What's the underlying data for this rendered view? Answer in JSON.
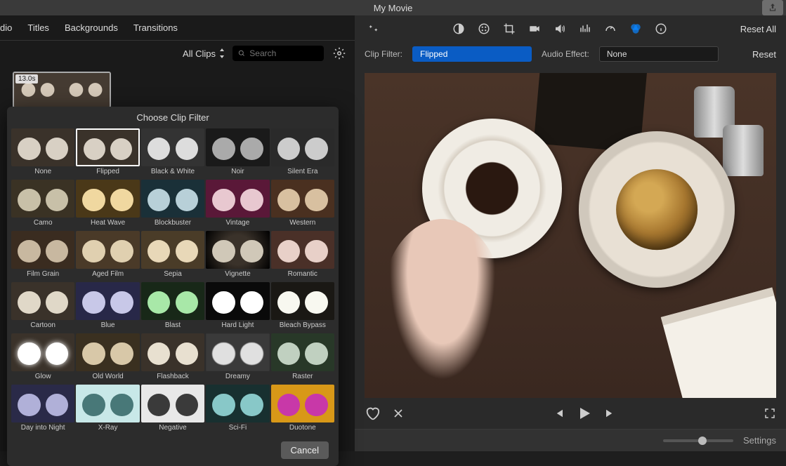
{
  "title": "My Movie",
  "tabs": [
    "dio",
    "Titles",
    "Backgrounds",
    "Transitions"
  ],
  "browser": {
    "all_clips": "All Clips",
    "search_placeholder": "Search"
  },
  "clip": {
    "duration": "13.0s"
  },
  "toolbar": {
    "reset_all": "Reset All"
  },
  "filter_bar": {
    "clip_filter_label": "Clip Filter:",
    "clip_filter_value": "Flipped",
    "audio_effect_label": "Audio Effect:",
    "audio_effect_value": "None",
    "reset": "Reset"
  },
  "modal": {
    "title": "Choose Clip Filter",
    "cancel": "Cancel",
    "selected": "Flipped",
    "filters": [
      {
        "name": "None",
        "cls": "f-none"
      },
      {
        "name": "Flipped",
        "cls": "f-flipped"
      },
      {
        "name": "Black & White",
        "cls": "f-bw"
      },
      {
        "name": "Noir",
        "cls": "f-noir"
      },
      {
        "name": "Silent Era",
        "cls": "f-silent"
      },
      {
        "name": "Camo",
        "cls": "f-camo"
      },
      {
        "name": "Heat Wave",
        "cls": "f-heat"
      },
      {
        "name": "Blockbuster",
        "cls": "f-block"
      },
      {
        "name": "Vintage",
        "cls": "f-vintage"
      },
      {
        "name": "Western",
        "cls": "f-western"
      },
      {
        "name": "Film Grain",
        "cls": "f-grain"
      },
      {
        "name": "Aged Film",
        "cls": "f-aged"
      },
      {
        "name": "Sepia",
        "cls": "f-sepia"
      },
      {
        "name": "Vignette",
        "cls": "f-vignette"
      },
      {
        "name": "Romantic",
        "cls": "f-romantic"
      },
      {
        "name": "Cartoon",
        "cls": "f-cartoon"
      },
      {
        "name": "Blue",
        "cls": "f-blue"
      },
      {
        "name": "Blast",
        "cls": "f-blast"
      },
      {
        "name": "Hard Light",
        "cls": "f-hard"
      },
      {
        "name": "Bleach Bypass",
        "cls": "f-bleach"
      },
      {
        "name": "Glow",
        "cls": "f-glow"
      },
      {
        "name": "Old World",
        "cls": "f-old"
      },
      {
        "name": "Flashback",
        "cls": "f-flash"
      },
      {
        "name": "Dreamy",
        "cls": "f-dreamy"
      },
      {
        "name": "Raster",
        "cls": "f-raster"
      },
      {
        "name": "Day into Night",
        "cls": "f-day"
      },
      {
        "name": "X-Ray",
        "cls": "f-xray"
      },
      {
        "name": "Negative",
        "cls": "f-neg"
      },
      {
        "name": "Sci-Fi",
        "cls": "f-scifi"
      },
      {
        "name": "Duotone",
        "cls": "f-duo"
      }
    ]
  },
  "footer": {
    "settings": "Settings"
  }
}
